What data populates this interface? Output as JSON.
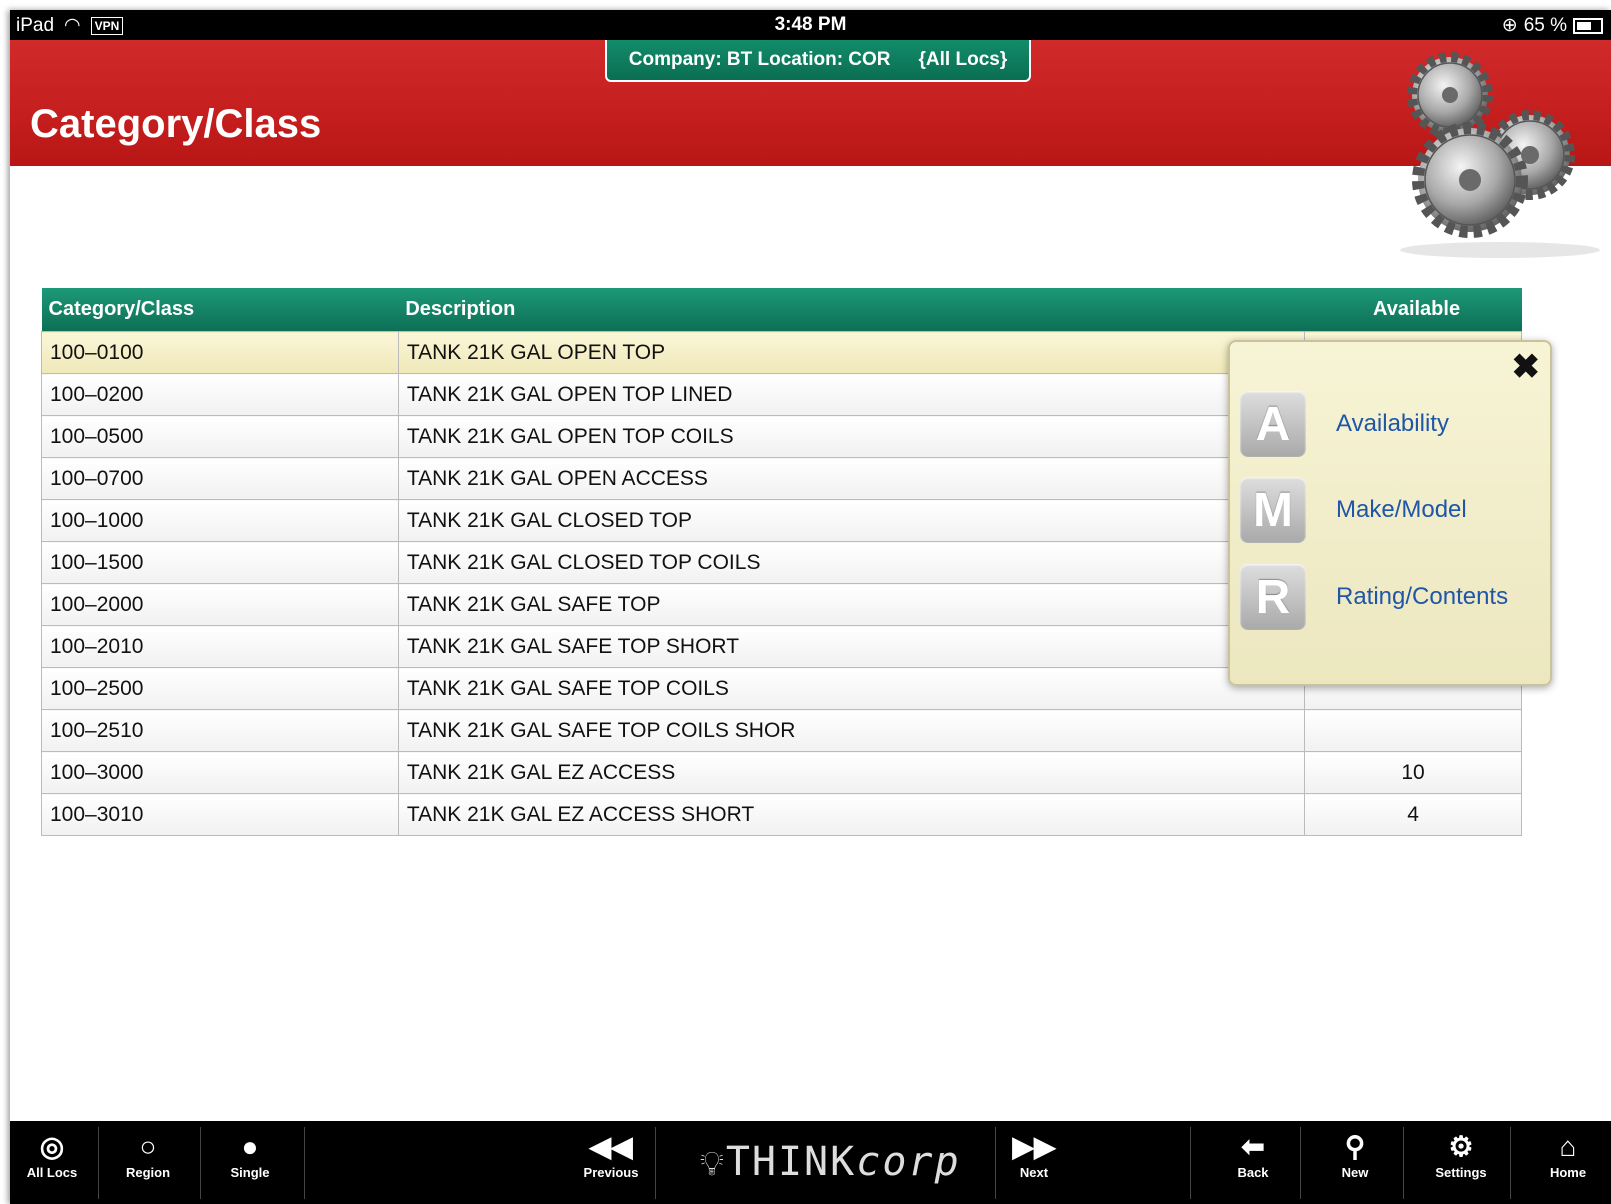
{
  "status_bar": {
    "device": "iPad",
    "vpn": "VPN",
    "time": "3:48 PM",
    "battery": "65 %"
  },
  "header": {
    "title": "Category/Class",
    "company": "Company: BT Location: COR",
    "locs": "{All Locs}"
  },
  "table": {
    "columns": [
      "Category/Class",
      "Description",
      "Available"
    ],
    "rows": [
      {
        "code": "100–0100",
        "desc": "TANK 21K GAL OPEN TOP",
        "avail": ""
      },
      {
        "code": "100–0200",
        "desc": "TANK 21K GAL OPEN TOP LINED",
        "avail": ""
      },
      {
        "code": "100–0500",
        "desc": "TANK 21K GAL OPEN TOP COILS",
        "avail": ""
      },
      {
        "code": "100–0700",
        "desc": "TANK 21K GAL OPEN ACCESS",
        "avail": ""
      },
      {
        "code": "100–1000",
        "desc": "TANK 21K GAL CLOSED TOP",
        "avail": ""
      },
      {
        "code": "100–1500",
        "desc": "TANK 21K GAL CLOSED TOP COILS",
        "avail": ""
      },
      {
        "code": "100–2000",
        "desc": "TANK 21K GAL SAFE TOP",
        "avail": ""
      },
      {
        "code": "100–2010",
        "desc": "TANK 21K GAL SAFE TOP SHORT",
        "avail": ""
      },
      {
        "code": "100–2500",
        "desc": "TANK 21K GAL SAFE TOP COILS",
        "avail": ""
      },
      {
        "code": "100–2510",
        "desc": "TANK 21K GAL SAFE TOP COILS SHOR",
        "avail": ""
      },
      {
        "code": "100–3000",
        "desc": "TANK 21K GAL EZ ACCESS",
        "avail": "10"
      },
      {
        "code": "100–3010",
        "desc": "TANK 21K GAL EZ ACCESS SHORT",
        "avail": "4"
      }
    ]
  },
  "popover": {
    "items": [
      {
        "letter": "A",
        "label": "Availability"
      },
      {
        "letter": "M",
        "label": "Make/Model"
      },
      {
        "letter": "R",
        "label": "Rating/Contents"
      }
    ]
  },
  "toolbar": {
    "all_locs": "All Locs",
    "region": "Region",
    "single": "Single",
    "previous": "Previous",
    "brand_think": "THINK",
    "brand_corp": "corp",
    "next": "Next",
    "back": "Back",
    "new": "New",
    "settings": "Settings",
    "home": "Home"
  },
  "colors": {
    "header_red": "#c51e1e",
    "table_header_green": "#128c6a",
    "link_blue": "#1f56a8",
    "popover_bg": "#f3efcd"
  }
}
